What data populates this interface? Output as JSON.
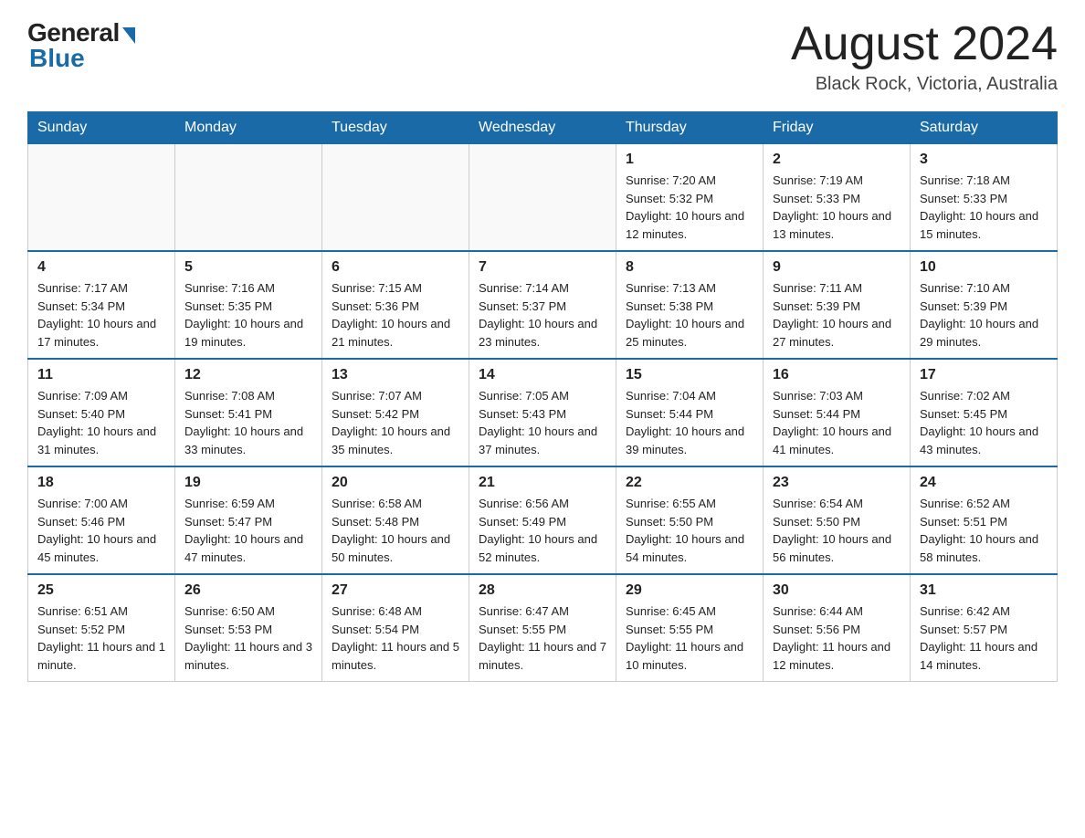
{
  "header": {
    "logo_general": "General",
    "logo_blue": "Blue",
    "month_title": "August 2024",
    "location": "Black Rock, Victoria, Australia"
  },
  "calendar": {
    "days_of_week": [
      "Sunday",
      "Monday",
      "Tuesday",
      "Wednesday",
      "Thursday",
      "Friday",
      "Saturday"
    ],
    "weeks": [
      [
        {
          "day": "",
          "info": ""
        },
        {
          "day": "",
          "info": ""
        },
        {
          "day": "",
          "info": ""
        },
        {
          "day": "",
          "info": ""
        },
        {
          "day": "1",
          "info": "Sunrise: 7:20 AM\nSunset: 5:32 PM\nDaylight: 10 hours and 12 minutes."
        },
        {
          "day": "2",
          "info": "Sunrise: 7:19 AM\nSunset: 5:33 PM\nDaylight: 10 hours and 13 minutes."
        },
        {
          "day": "3",
          "info": "Sunrise: 7:18 AM\nSunset: 5:33 PM\nDaylight: 10 hours and 15 minutes."
        }
      ],
      [
        {
          "day": "4",
          "info": "Sunrise: 7:17 AM\nSunset: 5:34 PM\nDaylight: 10 hours and 17 minutes."
        },
        {
          "day": "5",
          "info": "Sunrise: 7:16 AM\nSunset: 5:35 PM\nDaylight: 10 hours and 19 minutes."
        },
        {
          "day": "6",
          "info": "Sunrise: 7:15 AM\nSunset: 5:36 PM\nDaylight: 10 hours and 21 minutes."
        },
        {
          "day": "7",
          "info": "Sunrise: 7:14 AM\nSunset: 5:37 PM\nDaylight: 10 hours and 23 minutes."
        },
        {
          "day": "8",
          "info": "Sunrise: 7:13 AM\nSunset: 5:38 PM\nDaylight: 10 hours and 25 minutes."
        },
        {
          "day": "9",
          "info": "Sunrise: 7:11 AM\nSunset: 5:39 PM\nDaylight: 10 hours and 27 minutes."
        },
        {
          "day": "10",
          "info": "Sunrise: 7:10 AM\nSunset: 5:39 PM\nDaylight: 10 hours and 29 minutes."
        }
      ],
      [
        {
          "day": "11",
          "info": "Sunrise: 7:09 AM\nSunset: 5:40 PM\nDaylight: 10 hours and 31 minutes."
        },
        {
          "day": "12",
          "info": "Sunrise: 7:08 AM\nSunset: 5:41 PM\nDaylight: 10 hours and 33 minutes."
        },
        {
          "day": "13",
          "info": "Sunrise: 7:07 AM\nSunset: 5:42 PM\nDaylight: 10 hours and 35 minutes."
        },
        {
          "day": "14",
          "info": "Sunrise: 7:05 AM\nSunset: 5:43 PM\nDaylight: 10 hours and 37 minutes."
        },
        {
          "day": "15",
          "info": "Sunrise: 7:04 AM\nSunset: 5:44 PM\nDaylight: 10 hours and 39 minutes."
        },
        {
          "day": "16",
          "info": "Sunrise: 7:03 AM\nSunset: 5:44 PM\nDaylight: 10 hours and 41 minutes."
        },
        {
          "day": "17",
          "info": "Sunrise: 7:02 AM\nSunset: 5:45 PM\nDaylight: 10 hours and 43 minutes."
        }
      ],
      [
        {
          "day": "18",
          "info": "Sunrise: 7:00 AM\nSunset: 5:46 PM\nDaylight: 10 hours and 45 minutes."
        },
        {
          "day": "19",
          "info": "Sunrise: 6:59 AM\nSunset: 5:47 PM\nDaylight: 10 hours and 47 minutes."
        },
        {
          "day": "20",
          "info": "Sunrise: 6:58 AM\nSunset: 5:48 PM\nDaylight: 10 hours and 50 minutes."
        },
        {
          "day": "21",
          "info": "Sunrise: 6:56 AM\nSunset: 5:49 PM\nDaylight: 10 hours and 52 minutes."
        },
        {
          "day": "22",
          "info": "Sunrise: 6:55 AM\nSunset: 5:50 PM\nDaylight: 10 hours and 54 minutes."
        },
        {
          "day": "23",
          "info": "Sunrise: 6:54 AM\nSunset: 5:50 PM\nDaylight: 10 hours and 56 minutes."
        },
        {
          "day": "24",
          "info": "Sunrise: 6:52 AM\nSunset: 5:51 PM\nDaylight: 10 hours and 58 minutes."
        }
      ],
      [
        {
          "day": "25",
          "info": "Sunrise: 6:51 AM\nSunset: 5:52 PM\nDaylight: 11 hours and 1 minute."
        },
        {
          "day": "26",
          "info": "Sunrise: 6:50 AM\nSunset: 5:53 PM\nDaylight: 11 hours and 3 minutes."
        },
        {
          "day": "27",
          "info": "Sunrise: 6:48 AM\nSunset: 5:54 PM\nDaylight: 11 hours and 5 minutes."
        },
        {
          "day": "28",
          "info": "Sunrise: 6:47 AM\nSunset: 5:55 PM\nDaylight: 11 hours and 7 minutes."
        },
        {
          "day": "29",
          "info": "Sunrise: 6:45 AM\nSunset: 5:55 PM\nDaylight: 11 hours and 10 minutes."
        },
        {
          "day": "30",
          "info": "Sunrise: 6:44 AM\nSunset: 5:56 PM\nDaylight: 11 hours and 12 minutes."
        },
        {
          "day": "31",
          "info": "Sunrise: 6:42 AM\nSunset: 5:57 PM\nDaylight: 11 hours and 14 minutes."
        }
      ]
    ]
  }
}
